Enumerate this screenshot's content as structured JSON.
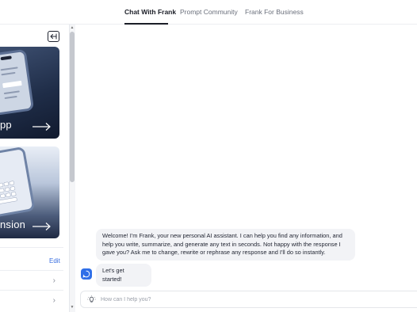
{
  "nav": {
    "tabs": [
      {
        "label": "Chat With Frank",
        "active": true
      },
      {
        "label": "Prompt Community",
        "active": false
      },
      {
        "label": "Frank For Business",
        "active": false
      }
    ]
  },
  "sidebar": {
    "collapse_icon": "collapse-left-icon",
    "cards": [
      {
        "label": "pp",
        "arrow_icon": "arrow-right-icon"
      },
      {
        "label": "nsion",
        "arrow_icon": "arrow-right-icon"
      }
    ],
    "edit_label": "Edit"
  },
  "chat": {
    "messages": [
      {
        "text": "Welcome! I'm Frank, your new personal AI assistant. I can help you find any information, and help you write, summarize, and generate any text in seconds. Not happy with the response I gave you? Ask me to change, rewrite or rephrase any response and I'll do so instantly."
      },
      {
        "text": "Let's get started!"
      }
    ],
    "input": {
      "placeholder": "How can I help you?",
      "value": ""
    }
  },
  "colors": {
    "accent": "#2f6fe8",
    "link": "#3a6fe0",
    "bubble": "#f2f3f6"
  }
}
